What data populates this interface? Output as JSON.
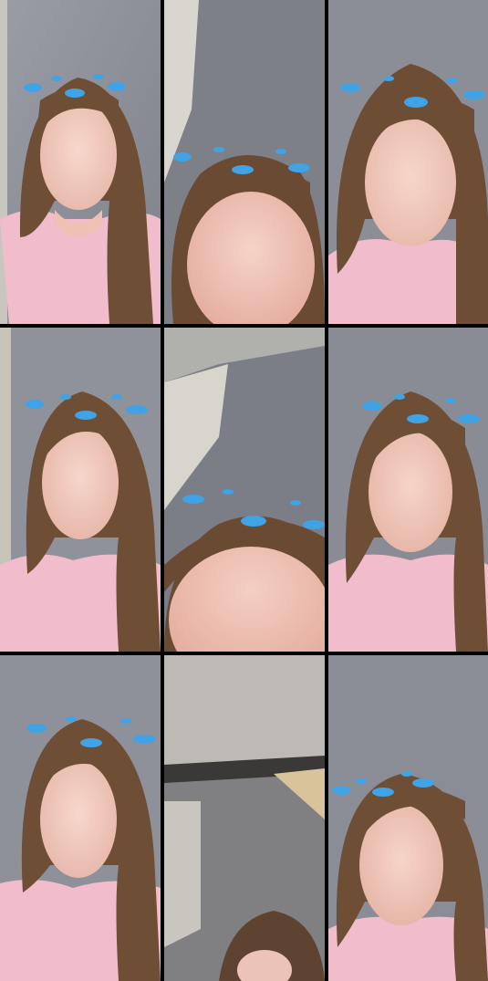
{
  "grid": {
    "rows": 3,
    "columns": 3,
    "frame_count": 9
  },
  "colors": {
    "gutter": "#000000",
    "wall": "#8d9099",
    "skin": "#eec9bd",
    "hair": "#6e4f36",
    "top": "#f1bccc",
    "bird": "#3fa3e6"
  },
  "frames": [
    {
      "id": "frame-1",
      "scene": "portrait-left-with-bird-headband"
    },
    {
      "id": "frame-2",
      "scene": "close-up-tilted-face-with-birds"
    },
    {
      "id": "frame-3",
      "scene": "portrait-centered-with-birds"
    },
    {
      "id": "frame-4",
      "scene": "portrait-left-with-bird-headband"
    },
    {
      "id": "frame-5",
      "scene": "wall-and-ceiling-face-at-bottom"
    },
    {
      "id": "frame-6",
      "scene": "portrait-centered-with-birds"
    },
    {
      "id": "frame-7",
      "scene": "portrait-left-with-bird-headband"
    },
    {
      "id": "frame-8",
      "scene": "room-ceiling-head-at-bottom"
    },
    {
      "id": "frame-9",
      "scene": "portrait-eyes-closed-with-birds"
    }
  ]
}
